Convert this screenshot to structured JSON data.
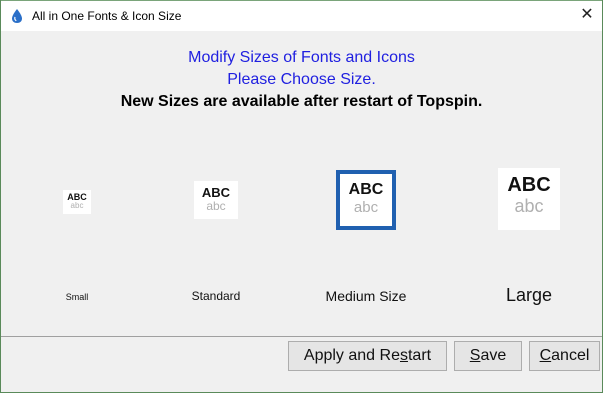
{
  "window": {
    "title": "All in One Fonts & Icon Size",
    "close_glyph": "✕"
  },
  "header": {
    "line1": "Modify Sizes of Fonts and Icons",
    "line2": "Please Choose Size.",
    "line3": "New Sizes are available after restart of Topspin."
  },
  "options": [
    {
      "upper": "ABC",
      "lower": "abc",
      "label": "Small",
      "selected": false
    },
    {
      "upper": "ABC",
      "lower": "abc",
      "label": "Standard",
      "selected": false
    },
    {
      "upper": "ABC",
      "lower": "abc",
      "label": "Medium Size",
      "selected": true
    },
    {
      "upper": "ABC",
      "lower": "abc",
      "label": "Large",
      "selected": false
    }
  ],
  "buttons": {
    "apply_prefix": "Apply and Re",
    "apply_mnemonic": "s",
    "apply_suffix": "tart",
    "save_mnemonic": "S",
    "save_rest": "ave",
    "cancel_mnemonic": "C",
    "cancel_rest": "ancel"
  },
  "colors": {
    "heading_blue": "#2020e0",
    "selection_border": "#2060b0"
  },
  "icons": {
    "app": "topspin-drop-icon",
    "close": "close-icon"
  }
}
